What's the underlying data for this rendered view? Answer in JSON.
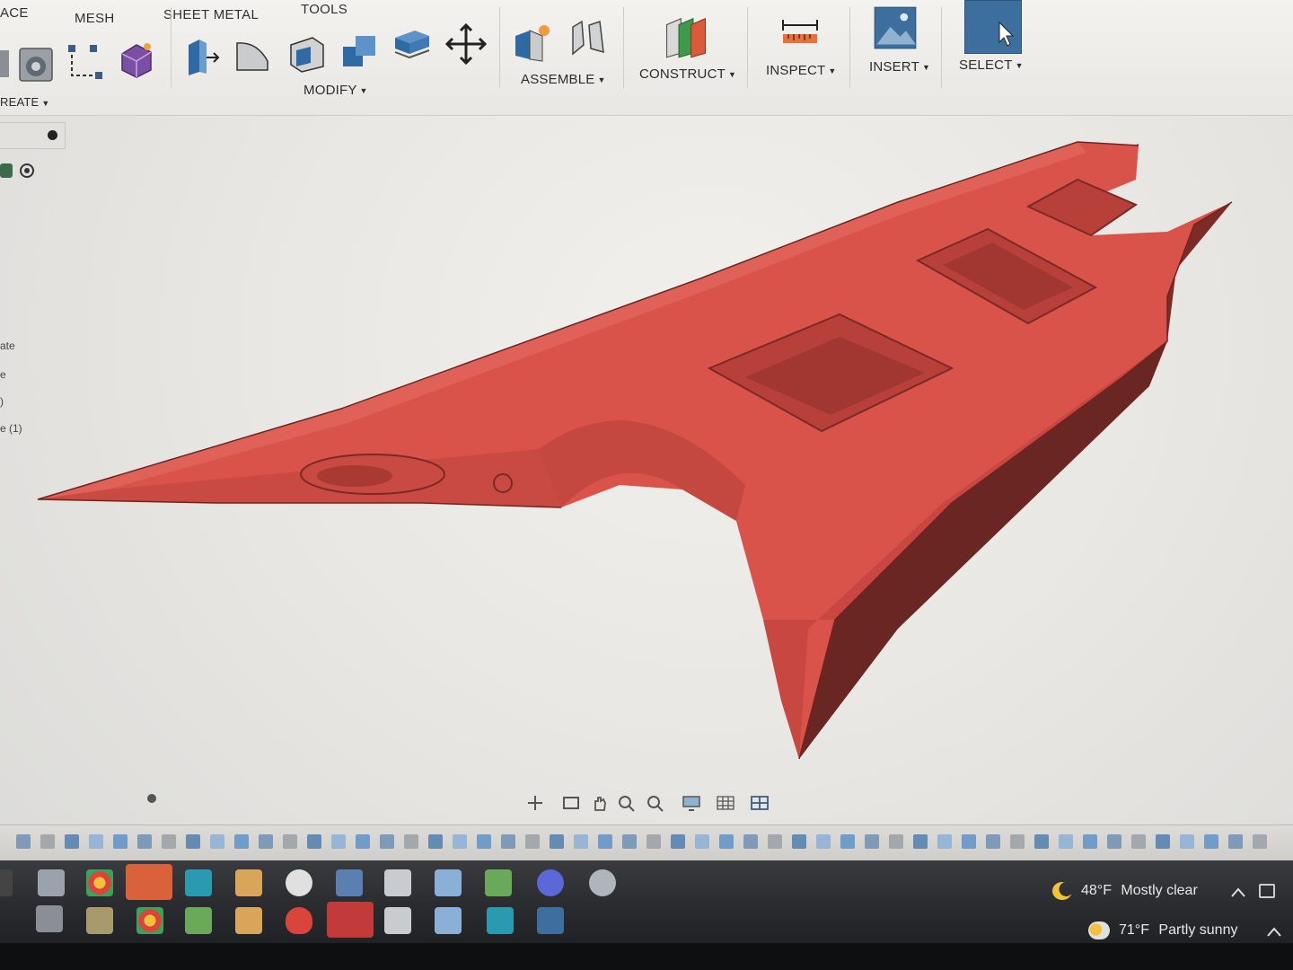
{
  "toolbar": {
    "tabs": [
      "ACE",
      "MESH",
      "SHEET METAL",
      "TOOLS"
    ],
    "groups": {
      "create": "REATE",
      "modify": "MODIFY",
      "assemble": "ASSEMBLE",
      "construct": "CONSTRUCT",
      "inspect": "INSPECT",
      "insert": "INSERT",
      "select": "SELECT"
    }
  },
  "left_panel": {
    "rows": [
      "ate",
      "e",
      ")",
      "e (1)"
    ]
  },
  "model": {
    "color": "#d9534a",
    "shadow_color": "#7a2a25"
  },
  "colors": {
    "accent": "#3d6f9e",
    "toolbar_bg": "#efeeea"
  },
  "taskbar": {
    "row1": {
      "weather_temp": "48°F",
      "weather_text": "Mostly clear"
    },
    "row2": {
      "weather_temp": "71°F",
      "weather_text": "Partly sunny"
    }
  }
}
